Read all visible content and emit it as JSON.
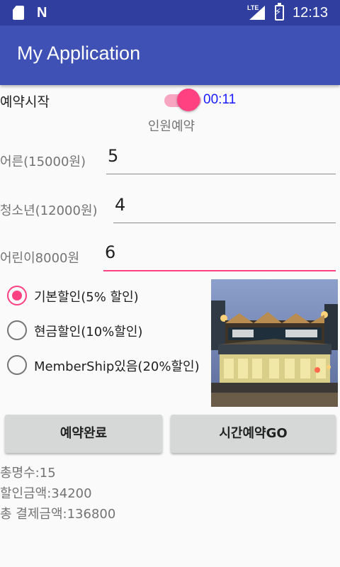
{
  "status_bar": {
    "time": "12:13",
    "network": "LTE",
    "icons": [
      "sd-card-icon",
      "n-notification-icon",
      "signal-icon",
      "battery-charging-icon"
    ]
  },
  "app_bar": {
    "title": "My Application"
  },
  "reservation": {
    "label": "예약시작",
    "switch_on": true,
    "timer": "00:11"
  },
  "section_title": "인원예약",
  "fields": [
    {
      "label": "어른(15000원)",
      "value": "5"
    },
    {
      "label": "청소년(12000원)",
      "value": "4"
    },
    {
      "label": "어린이8000원",
      "value": "6"
    }
  ],
  "discounts": [
    {
      "label": "기본할인(5% 할인)",
      "checked": true
    },
    {
      "label": "현금할인(10%할인)",
      "checked": false
    },
    {
      "label": "MemberShip있음(20%할인)",
      "checked": false
    }
  ],
  "buttons": {
    "complete": "예약완료",
    "time_reserve": "시간예약GO"
  },
  "summary": {
    "total_people": "총명수:15",
    "discount_amount": "할인금액:34200",
    "total_payment": "총 결제금액:136800"
  },
  "colors": {
    "primary": "#3f51b5",
    "primary_dark": "#303f9f",
    "accent": "#ff4081",
    "timer": "#1a1aff"
  }
}
